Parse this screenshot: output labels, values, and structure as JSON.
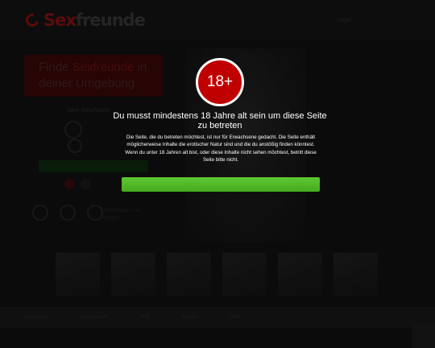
{
  "header": {
    "logo": {
      "brand_part1": "Sex",
      "brand_part2": "freunde",
      "icon": "heart-logo-icon"
    },
    "login_label": "Login"
  },
  "promo": {
    "line1_prefix": "Finde ",
    "line1_highlight": "Sexfreunde",
    "line1_suffix": " in",
    "line2": "deiner Umgebung"
  },
  "widget": {
    "title": "Dein Geschlecht"
  },
  "badges_text": {
    "line1": "100% Diskret und",
    "line2": "Anonym"
  },
  "footer": {
    "links": [
      "Impressum",
      "Datenschutz",
      "AGB",
      "Kontakt",
      "Hilfe"
    ]
  },
  "age_gate": {
    "badge_text": "18+",
    "title": "Du musst mindestens 18 Jahre alt sein um diese Seite zu betreten",
    "body": "Die Seite, die du betreten möchtest, ist nur für Erwachsene gedacht. Die Seite enthält möglicherweise Inhalte die erotischer Natur sind und die du anstößig finden könntest. Wenn du unter 18 Jahren alt bist, oder diese Inhalte nicht sehen möchtest, betritt diese Seite bitte nicht.",
    "enter_label": ""
  },
  "colors": {
    "badge_red": "#c00000",
    "button_green": "#4cb327",
    "brand_red": "#8e1212",
    "overlay_text": "#ffffff"
  }
}
